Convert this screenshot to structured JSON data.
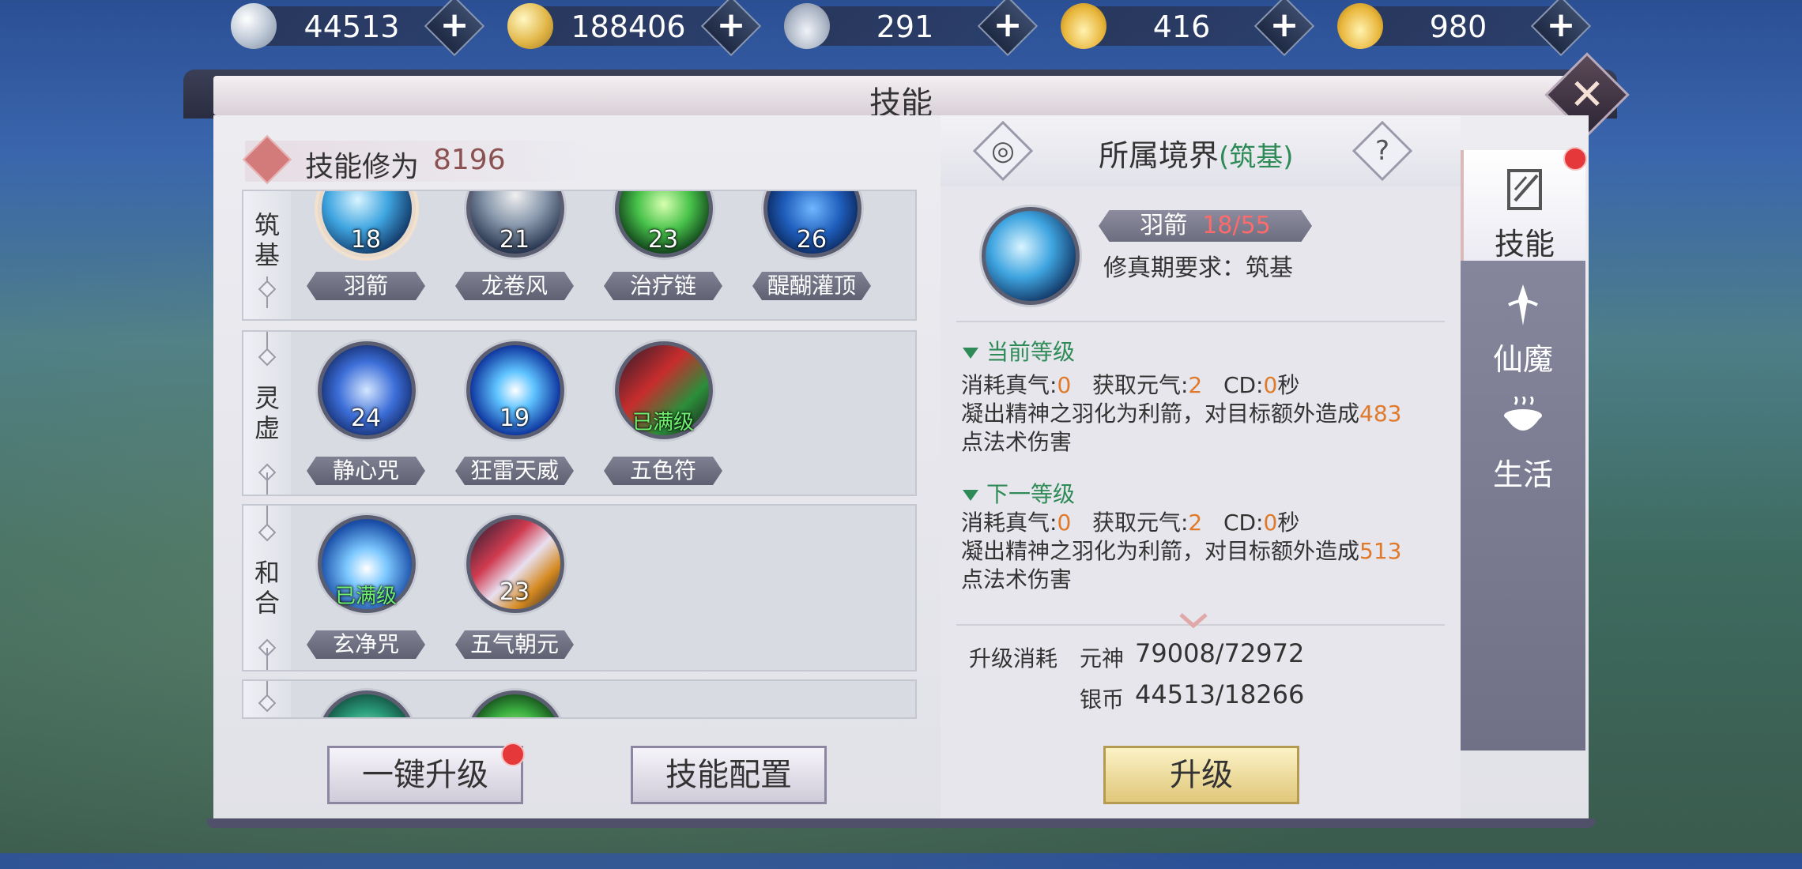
{
  "currencies": [
    {
      "icon": "silver-coin-icon",
      "value": "44513"
    },
    {
      "icon": "gold-coin-icon",
      "value": "188406"
    },
    {
      "icon": "silver-ingot-icon",
      "value": "291"
    },
    {
      "icon": "locked-gold-ingot-icon",
      "value": "416"
    },
    {
      "icon": "gold-ingot-icon",
      "value": "980"
    }
  ],
  "window": {
    "title": "技能",
    "close_glyph": "✕"
  },
  "cultivation": {
    "label": "技能修为",
    "value": "8196"
  },
  "realms": [
    {
      "name": "筑基",
      "skills": [
        {
          "name": "羽箭",
          "level": "18"
        },
        {
          "name": "龙卷风",
          "level": "21"
        },
        {
          "name": "治疗链",
          "level": "23"
        },
        {
          "name": "醍醐灌顶",
          "level": "26"
        }
      ]
    },
    {
      "name": "灵虚",
      "skills": [
        {
          "name": "静心咒",
          "level": "24"
        },
        {
          "name": "狂雷天威",
          "level": "19"
        },
        {
          "name": "五色符",
          "level": "已满级"
        }
      ]
    },
    {
      "name": "和合",
      "skills": [
        {
          "name": "玄净咒",
          "level": "已满级"
        },
        {
          "name": "五气朝元",
          "level": "23"
        }
      ]
    }
  ],
  "buttons": {
    "one_click_upgrade": "一键升级",
    "skill_config": "技能配置",
    "upgrade": "升级"
  },
  "detail": {
    "realm_label": "所属境界",
    "realm_value": "(筑基)",
    "help_glyph": "?",
    "skill_name": "羽箭",
    "skill_progress": "18/55",
    "requirement_label": "修真期要求：",
    "requirement_value": "筑基",
    "current": {
      "header": "当前等级",
      "cost_label": "消耗真气:",
      "cost_value": "0",
      "gain_label": "获取元气:",
      "gain_value": "2",
      "cd_label": "CD:",
      "cd_value": "0",
      "cd_unit": "秒",
      "desc_pre": "凝出精神之羽化为利箭，对目标额外造成",
      "desc_value": "483",
      "desc_post": "点法术伤害"
    },
    "next": {
      "header": "下一等级",
      "cost_label": "消耗真气:",
      "cost_value": "0",
      "gain_label": "获取元气:",
      "gain_value": "2",
      "cd_label": "CD:",
      "cd_value": "0",
      "cd_unit": "秒",
      "desc_pre": "凝出精神之羽化为利箭，对目标额外造成",
      "desc_value": "513",
      "desc_post": "点法术伤害"
    },
    "upgrade_cost": {
      "label": "升级消耗",
      "items": [
        {
          "name": "元神",
          "value": "79008/72972"
        },
        {
          "name": "银币",
          "value": "44513/18266"
        }
      ]
    }
  },
  "tabs": [
    {
      "label": "技能",
      "icon": "skill-book-icon",
      "active": true
    },
    {
      "label": "仙魔",
      "icon": "sword-icon",
      "active": false
    },
    {
      "label": "生活",
      "icon": "pot-icon",
      "active": false
    }
  ],
  "colors": {
    "accent_green": "#2e8b57",
    "highlight_orange": "#e07a2a",
    "progress_red": "#ff6a6a",
    "max_level_green": "#6ff06f",
    "notification_red": "#e4383a"
  }
}
